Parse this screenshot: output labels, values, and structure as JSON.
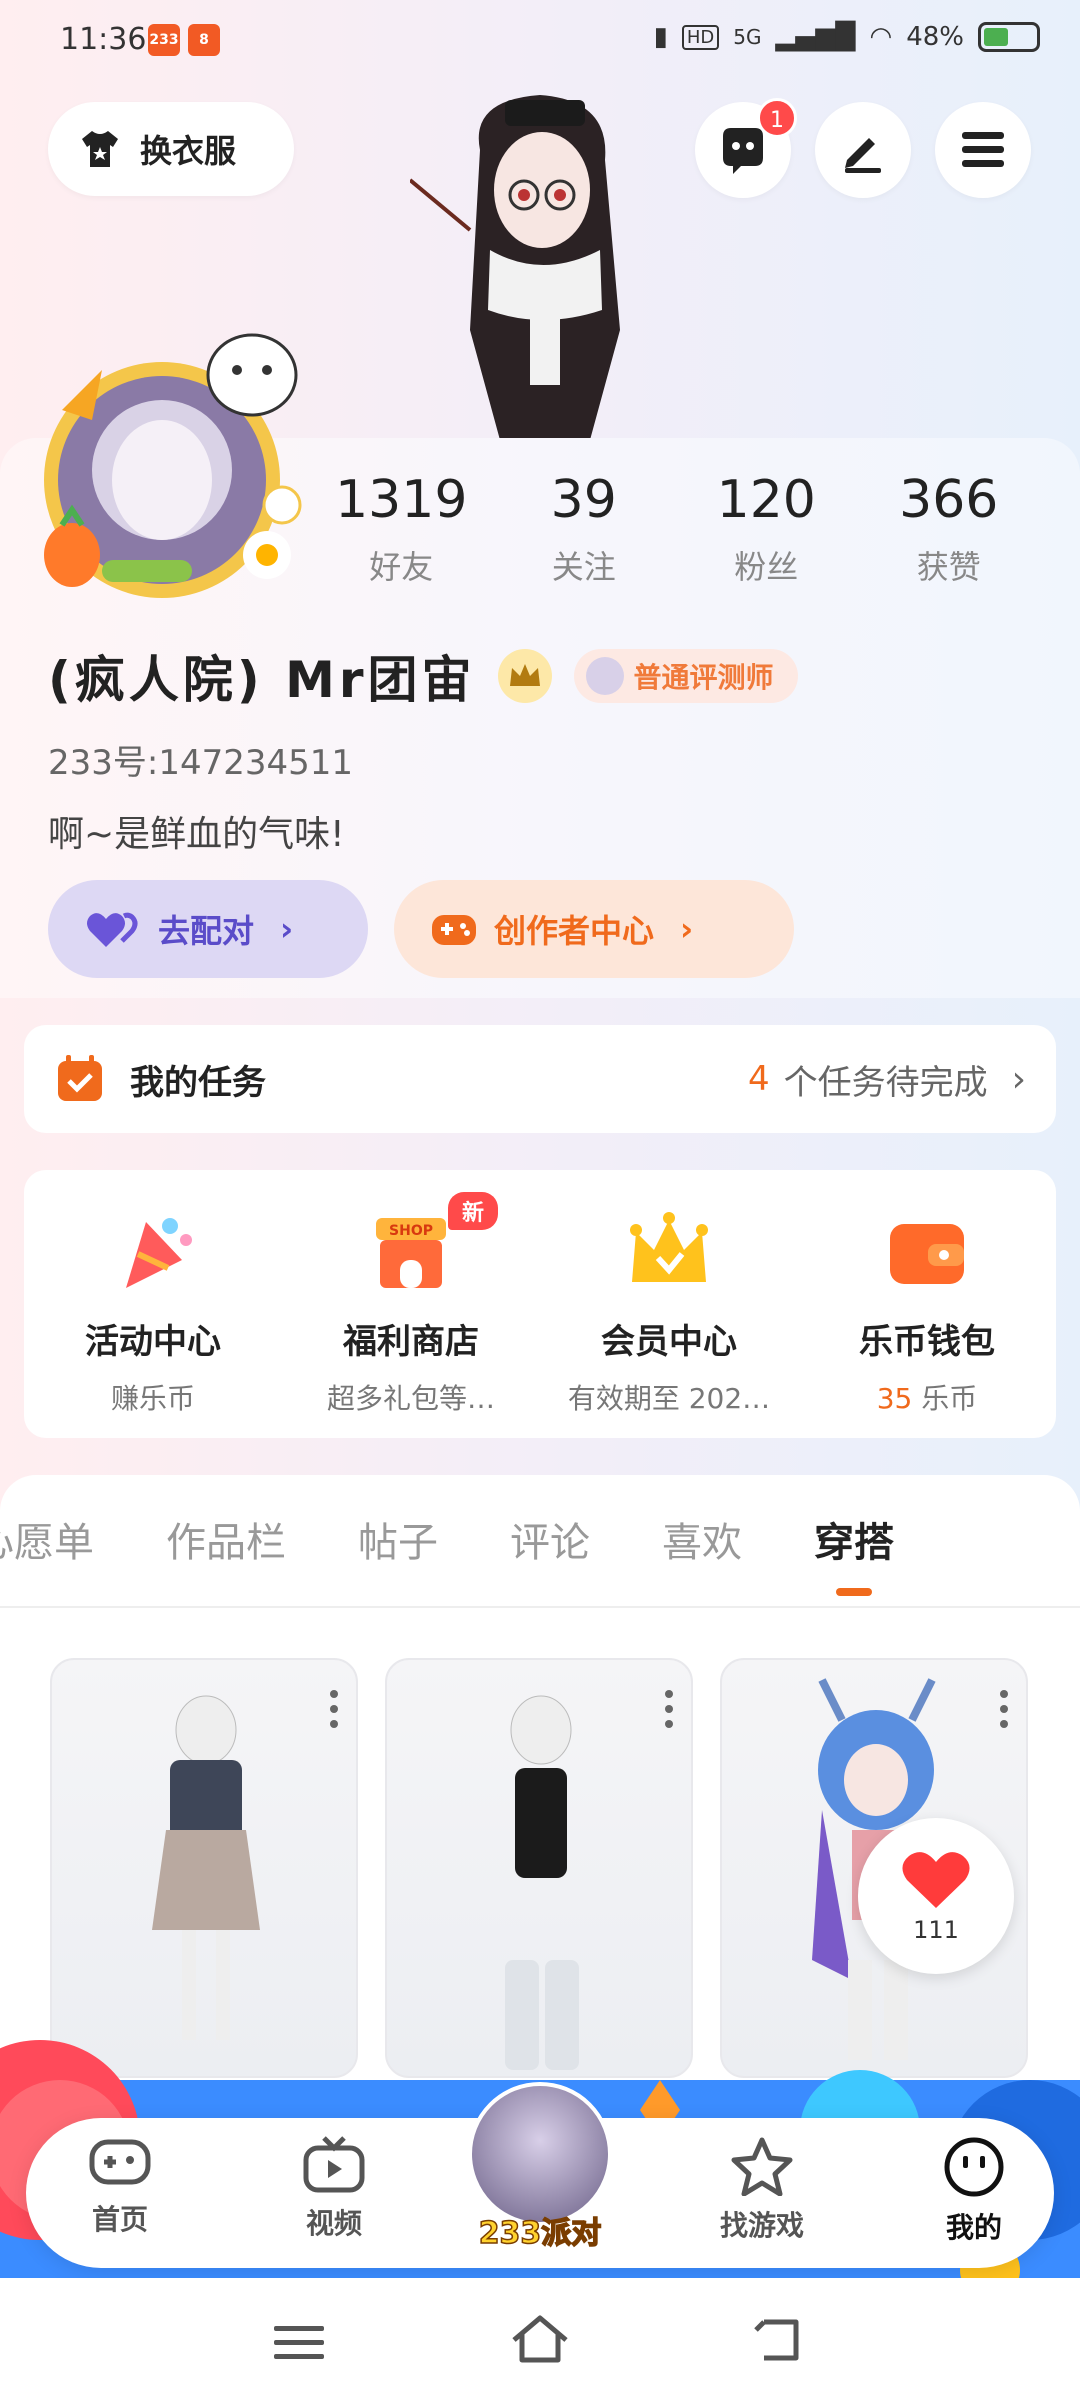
{
  "status_bar": {
    "time": "11:36",
    "badge1": "233",
    "badge2": "8",
    "network": "5G",
    "battery": "48%"
  },
  "top_bar": {
    "outfit_label": "换衣服",
    "message_count": "1"
  },
  "stats": [
    {
      "value": "1319",
      "label": "好友"
    },
    {
      "value": "39",
      "label": "关注"
    },
    {
      "value": "120",
      "label": "粉丝"
    },
    {
      "value": "366",
      "label": "获赞"
    }
  ],
  "profile": {
    "name": "(疯人院)   Mr团宙",
    "role_tag": "普通评测师",
    "uid": "233号:147234511",
    "signature": "啊~是鲜血的气味!"
  },
  "actions": {
    "match_label": "去配对",
    "creator_label": "创作者中心"
  },
  "tasks": {
    "title": "我的任务",
    "count": "4",
    "text": "个任务待完成"
  },
  "grid": [
    {
      "title": "活动中心",
      "sub": "赚乐币"
    },
    {
      "title": "福利商店",
      "sub": "超多礼包等…",
      "badge": "新"
    },
    {
      "title": "会员中心",
      "sub": "有效期至 202…"
    },
    {
      "title": "乐币钱包",
      "sub_num": "35",
      "sub": "乐币"
    }
  ],
  "tabs": [
    "心愿单",
    "作品栏",
    "帖子",
    "评论",
    "喜欢",
    "穿搭"
  ],
  "active_tab": "穿搭",
  "like_count": "111",
  "bottom_nav": [
    {
      "label": "首页"
    },
    {
      "label": "视频"
    },
    {
      "label": "233派对"
    },
    {
      "label": "找游戏"
    },
    {
      "label": "我的"
    }
  ],
  "colors": {
    "accent": "#f06a1c",
    "purple": "#5a4cc9"
  }
}
